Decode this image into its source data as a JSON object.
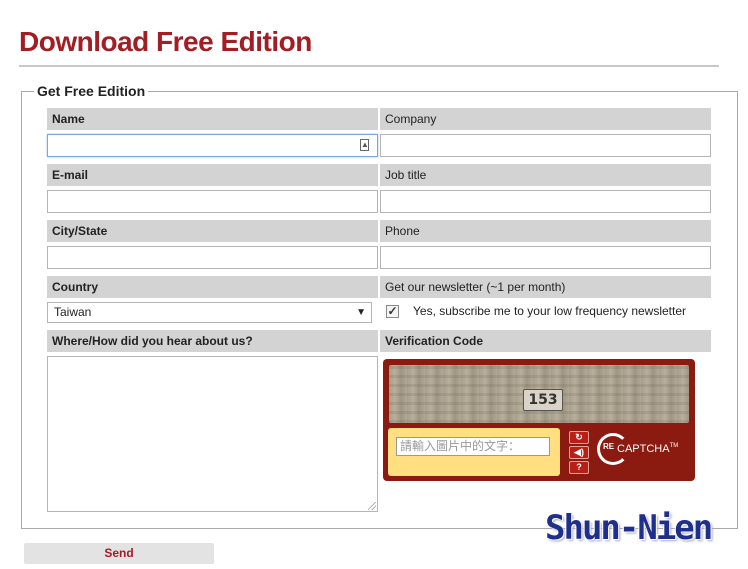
{
  "page": {
    "title": "Download Free Edition",
    "fieldset_legend": "Get Free Edition"
  },
  "form": {
    "name_label": "Name",
    "company_label": "Company",
    "email_label": "E-mail",
    "job_title_label": "Job title",
    "city_label": "City/State",
    "phone_label": "Phone",
    "country_label": "Country",
    "country_value": "Taiwan",
    "newsletter_label": "Get our newsletter (~1 per month)",
    "newsletter_checked": true,
    "newsletter_text": "Yes, subscribe me to your low frequency newsletter",
    "hear_label": "Where/How did you hear about us?",
    "verification_label": "Verification Code",
    "send_label": "Send"
  },
  "captcha": {
    "image_text": "153",
    "input_placeholder": "請輸入圖片中的文字：",
    "logo_prefix": "RE",
    "logo_text": "CAPTCHA",
    "logo_tm": "TM",
    "buttons": [
      "refresh-icon",
      "audio-icon",
      "help-icon"
    ]
  },
  "watermark": "Shun-Nien",
  "colors": {
    "brand_red": "#a21d24",
    "label_bg": "#d3d3d3",
    "captcha_bg": "#8b1a10",
    "captcha_input_bg": "#ffdf7f",
    "watermark": "#1f2f8c"
  }
}
